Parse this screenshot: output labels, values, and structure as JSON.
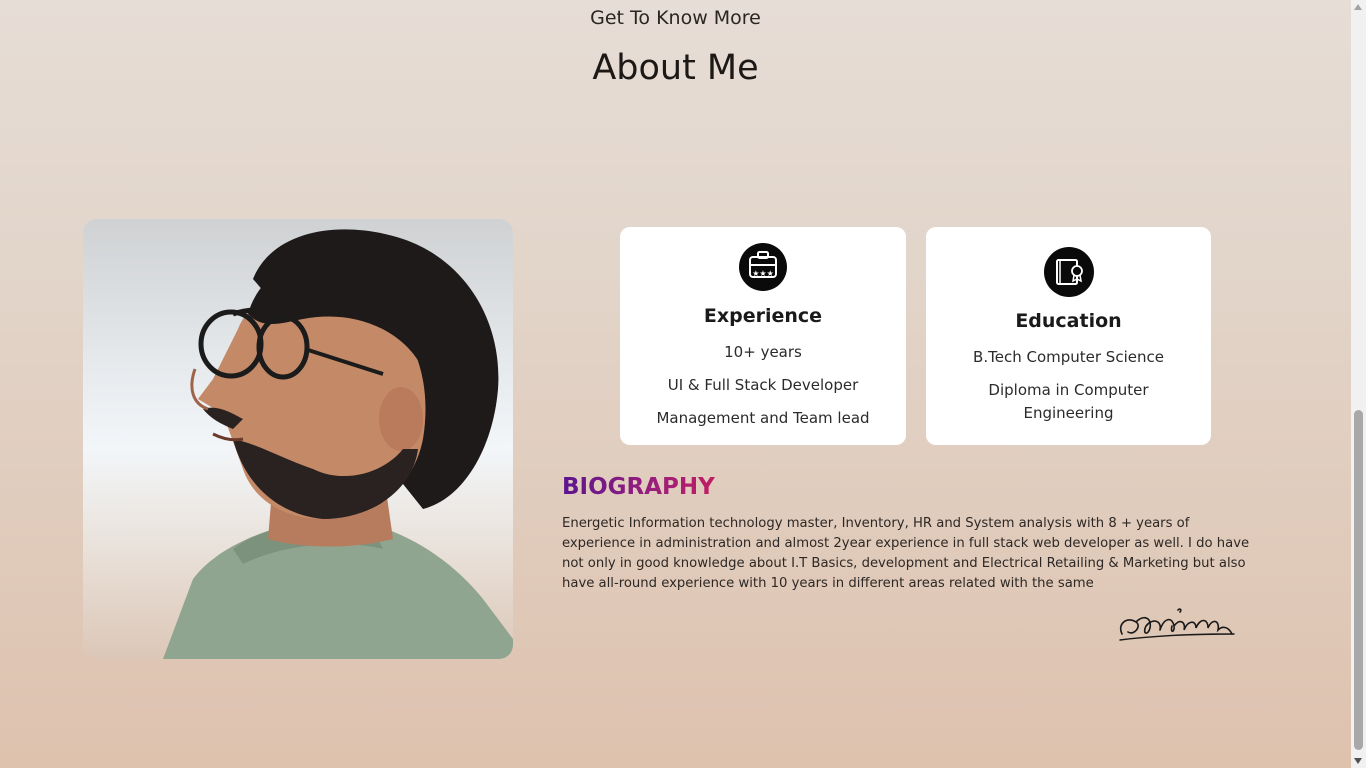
{
  "header": {
    "eyebrow": "Get To Know More",
    "title": "About Me"
  },
  "profile_image": {
    "alt": "Portrait photo"
  },
  "cards": [
    {
      "icon": "briefcase-stars-icon",
      "title": "Experience",
      "lines": [
        "10+ years",
        "UI & Full Stack Developer",
        "Management and Team lead"
      ]
    },
    {
      "icon": "education-book-badge-icon",
      "title": "Education",
      "lines": [
        "B.Tech Computer Science",
        "Diploma in Computer Engineering"
      ]
    }
  ],
  "biography": {
    "title": "BIOGRAPHY",
    "text": "Energetic Information technology master, Inventory, HR and System analysis with 8 + years of experience in administration and almost 2year experience in full stack web developer as well. I do have not only in good knowledge about I.T Basics, development and Electrical Retailing & Marketing but also have all-round experience with 10 years in different areas related with the same",
    "signature_icon": "handwritten-signature"
  },
  "colors": {
    "background_top": "#e6ddd6",
    "background_bottom": "#dec2ae",
    "card_background": "#ffffff",
    "bio_title_gradient_start": "#5b1490",
    "bio_title_gradient_end": "#c01e63",
    "icon_circle": "#0a0a0a"
  }
}
